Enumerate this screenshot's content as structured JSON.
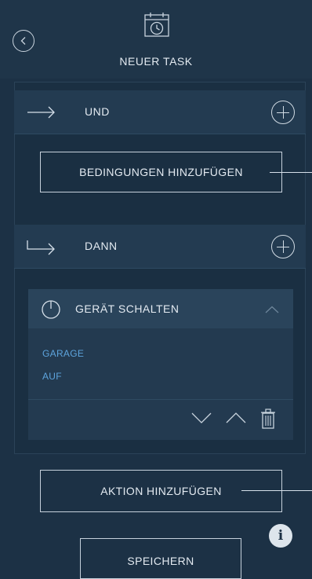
{
  "header": {
    "title": "NEUER TASK",
    "back_icon": "chevron-left-icon",
    "title_icon": "calendar-clock-icon"
  },
  "conditions": {
    "section_label": "UND",
    "add_condition_button": "BEDINGUNGEN HINZUFÜGEN"
  },
  "actions": {
    "section_label": "DANN",
    "action_card": {
      "title": "GERÄT SCHALTEN",
      "params": [
        "GARAGE",
        "AUF"
      ]
    },
    "add_action_button": "AKTION HINZUFÜGEN"
  },
  "footer": {
    "save_button": "SPEICHERN"
  },
  "colors": {
    "background": "#1c3145",
    "panel": "#233b51",
    "accent": "#5da4dd",
    "text": "#e3eaf1"
  }
}
